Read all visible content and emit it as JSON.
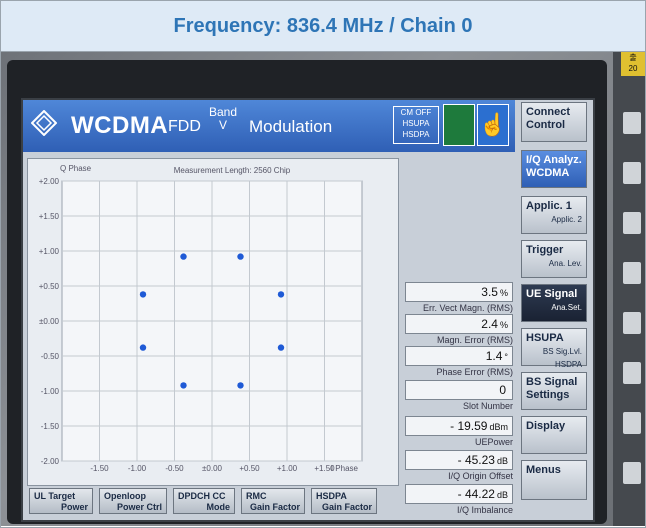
{
  "caption": "Frequency: 836.4 MHz / Chain 0",
  "header": {
    "brand": "WCDMA",
    "fdd": "FDD",
    "band_label": "Band",
    "band_value": "V",
    "title": "Modulation",
    "cm_lines": [
      "CM OFF",
      "HSUPA",
      "HSDPA"
    ]
  },
  "side_buttons": [
    {
      "label": "Connect Control",
      "sub": ""
    },
    {
      "label": "I/Q Analyz. WCDMA",
      "sub": ""
    },
    {
      "label": "Applic. 1",
      "sub": "Applic. 2"
    },
    {
      "label": "Trigger",
      "sub": "Ana. Lev."
    },
    {
      "label": "UE Signal",
      "sub": "Ana.Set."
    },
    {
      "label": "HSUPA",
      "sub": "BS Sig.Lvl. HSDPA"
    },
    {
      "label": "BS Signal Settings",
      "sub": ""
    },
    {
      "label": "Display",
      "sub": ""
    },
    {
      "label": "Menus",
      "sub": ""
    }
  ],
  "readouts": [
    {
      "value": "3.5",
      "unit": "%",
      "label": "Err. Vect Magn. (RMS)"
    },
    {
      "value": "2.4",
      "unit": "%",
      "label": "Magn. Error (RMS)"
    },
    {
      "value": "1.4",
      "unit": "°",
      "label": "Phase Error (RMS)"
    },
    {
      "value": "0",
      "unit": "",
      "label": "Slot Number"
    },
    {
      "value": "- 19.59",
      "unit": "dBm",
      "label": "UEPower"
    },
    {
      "value": "- 45.23",
      "unit": "dB",
      "label": "I/Q Origin Offset"
    },
    {
      "value": "- 44.22",
      "unit": "dB",
      "label": "I/Q Imbalance"
    }
  ],
  "bottom_buttons": [
    {
      "l1": "UL Target",
      "l2": "Power"
    },
    {
      "l1": "Openloop",
      "l2": "Power Ctrl"
    },
    {
      "l1": "DPDCH CC",
      "l2": "Mode"
    },
    {
      "l1": "RMC",
      "l2": "Gain Factor"
    },
    {
      "l1": "HSDPA",
      "l2": "Gain Factor"
    }
  ],
  "sticker": [
    "출",
    "20"
  ],
  "chart_data": {
    "type": "scatter",
    "title": "Measurement Length: 2560 Chip",
    "ylabel": "Q Phase",
    "xlabel": "I Phase",
    "xlim": [
      -2.0,
      2.0
    ],
    "ylim": [
      -2.0,
      2.0
    ],
    "x_ticks": [
      "-1.50",
      "-1.00",
      "-0.50",
      "±0.00",
      "+0.50",
      "+1.00",
      "+1.50"
    ],
    "y_ticks": [
      "+2.00",
      "+1.50",
      "+1.00",
      "+0.50",
      "±0.00",
      "-0.50",
      "-1.00",
      "-1.50",
      "-2.00"
    ],
    "grid": true,
    "points": [
      {
        "x": -0.38,
        "y": 0.92
      },
      {
        "x": 0.38,
        "y": 0.92
      },
      {
        "x": -0.92,
        "y": 0.38
      },
      {
        "x": 0.92,
        "y": 0.38
      },
      {
        "x": -0.92,
        "y": -0.38
      },
      {
        "x": 0.92,
        "y": -0.38
      },
      {
        "x": -0.38,
        "y": -0.92
      },
      {
        "x": 0.38,
        "y": -0.92
      }
    ]
  }
}
